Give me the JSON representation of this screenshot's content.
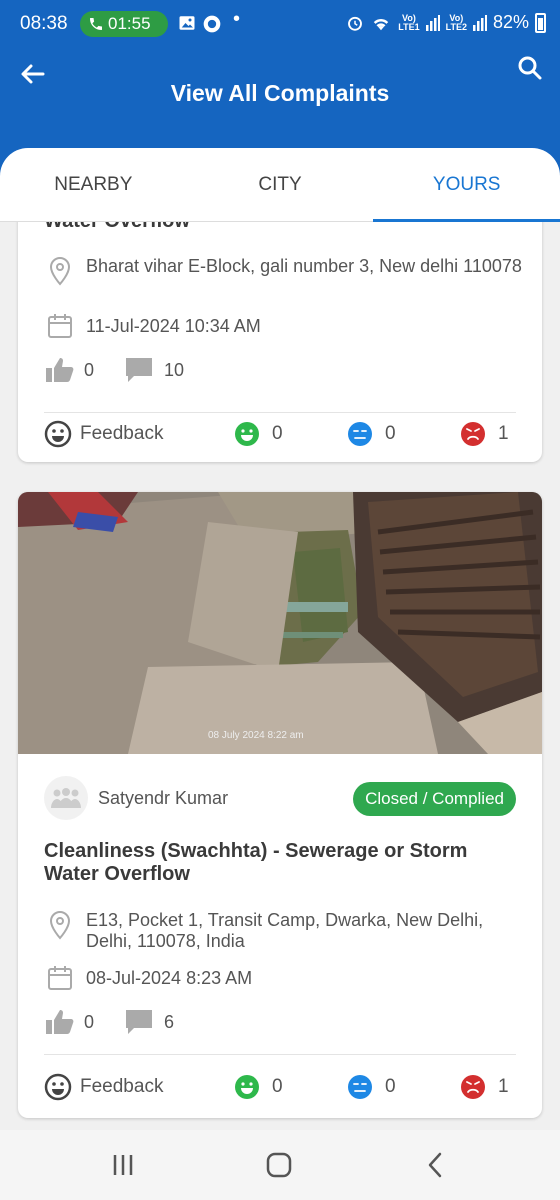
{
  "status_bar": {
    "time": "08:38",
    "call_duration": "01:55",
    "net1_line1": "Vo)",
    "net1_line2": "LTE1",
    "net2_line1": "Vo)",
    "net2_line2": "LTE2",
    "battery": "82%"
  },
  "header": {
    "title": "View All Complaints"
  },
  "tabs": [
    {
      "label": "NEARBY",
      "active": false
    },
    {
      "label": "CITY",
      "active": false
    },
    {
      "label": "YOURS",
      "active": true
    }
  ],
  "complaints": [
    {
      "title": "Water Overflow",
      "address": "Bharat vihar E-Block, gali number 3, New delhi 110078",
      "date": "11-Jul-2024 10:34 AM",
      "likes": "0",
      "comments": "10",
      "feedback_label": "Feedback",
      "happy": "0",
      "neutral": "0",
      "angry": "1"
    },
    {
      "photo_watermark": "08 July 2024 8:22 am",
      "user": "Satyendr Kumar",
      "status": "Closed / Complied",
      "title": "Cleanliness (Swachhta) - Sewerage or Storm Water Overflow",
      "address": "E13, Pocket 1, Transit Camp, Dwarka, New Delhi, Delhi, 110078, India",
      "date": "08-Jul-2024 8:23 AM",
      "likes": "0",
      "comments": "6",
      "feedback_label": "Feedback",
      "happy": "0",
      "neutral": "0",
      "angry": "1"
    }
  ],
  "colors": {
    "header": "#1565c0",
    "active_tab": "#1976d2",
    "status_closed": "#2fa84f",
    "happy": "#2eb84b",
    "neutral": "#1e88e5",
    "angry": "#d32f2f"
  },
  "icons": [
    "back-arrow-icon",
    "search-icon",
    "location-pin-icon",
    "calendar-icon",
    "thumbs-up-icon",
    "comment-icon",
    "smiley-icon",
    "happy-face-icon",
    "neutral-face-icon",
    "angry-face-icon",
    "recent-apps-icon",
    "home-icon",
    "back-icon"
  ]
}
